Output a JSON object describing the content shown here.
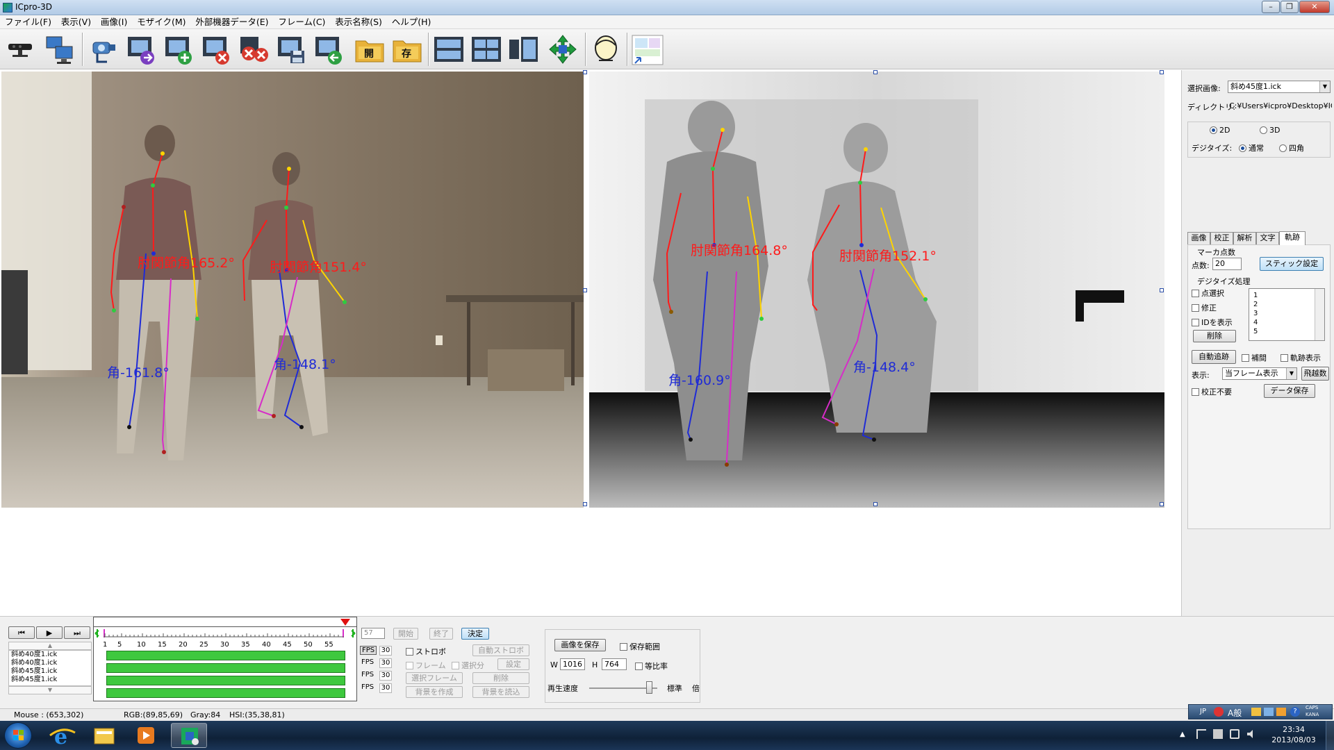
{
  "app": {
    "title": "ICpro-3D"
  },
  "menu": [
    "ファイル(F)",
    "表示(V)",
    "画像(I)",
    "モザイク(M)",
    "外部機器データ(E)",
    "フレーム(C)",
    "表示名称(S)",
    "ヘルプ(H)"
  ],
  "toolbar": {
    "icons": [
      "kinect-sensor-icon",
      "monitor-network-icon",
      "camera-link-icon",
      "film-next-icon",
      "film-add-icon",
      "film-remove-icon",
      "film-delete-icon",
      "film-save-icon",
      "film-back-icon",
      "folder-open-icon",
      "folder-save-icon",
      "film-grid-icon",
      "film-multi-icon",
      "film-split-icon",
      "move-arrows-icon",
      "head-model-icon",
      "preview-thumbnail-icon"
    ],
    "open_label": "開",
    "save_label": "存"
  },
  "colors": {
    "titlebar": "#b9d1ea",
    "accent_blue": "#1b4d9a",
    "frame_bar": "#3ec83e",
    "play_marker": "#e01010"
  },
  "rgb_view": {
    "angles": [
      {
        "label": "肘関節角165.2°",
        "color": "#ff1a1a"
      },
      {
        "label": "肘関節角151.4°",
        "color": "#ff1a1a"
      },
      {
        "label": "角-161.8°",
        "color": "#1f2bd6"
      },
      {
        "label": "角-148.1°",
        "color": "#1f2bd6"
      }
    ]
  },
  "depth_view": {
    "angles": [
      {
        "label": "肘関節角164.8°",
        "color": "#ff1a1a"
      },
      {
        "label": "肘関節角152.1°",
        "color": "#ff1a1a"
      },
      {
        "label": "角-160.9°",
        "color": "#1f2bd6"
      },
      {
        "label": "角-148.4°",
        "color": "#1f2bd6"
      }
    ]
  },
  "side": {
    "selected_image_label": "選択画像:",
    "selected_image_value": "斜め45度1.ick",
    "directory_label": "ディレクトリ:",
    "directory_value": "C:¥Users¥icpro¥Desktop¥IC",
    "mode_2d": "2D",
    "mode_3d": "3D",
    "digitize_label": "デジタイズ:",
    "digitize_normal": "通常",
    "digitize_square": "四角",
    "tabs": [
      "画像",
      "校正",
      "解析",
      "文字",
      "軌跡"
    ],
    "active_tab": "軌跡",
    "marker_count_label": "マーカ点数",
    "points_label": "点数:",
    "points_value": "20",
    "stick_button": "スティック設定",
    "digitize_proc_label": "デジタイズ処理",
    "point_select": "点選択",
    "modify": "修正",
    "show_id": "IDを表示",
    "delete_button": "削除",
    "point_list": [
      "1",
      "2",
      "3",
      "4",
      "5"
    ],
    "auto_track_button": "自動追跡",
    "interpolate": "補間",
    "show_track": "軌跡表示",
    "display_label": "表示:",
    "display_value": "当フレーム表示",
    "jump_button": "飛越数",
    "no_calibration": "校正不要",
    "data_save_button": "データ保存"
  },
  "timeline": {
    "ticks": [
      "1",
      "5",
      "10",
      "15",
      "20",
      "25",
      "30",
      "35",
      "40",
      "45",
      "50",
      "55"
    ],
    "current_frame": "57",
    "start_button": "開始",
    "end_button": "終了",
    "decide_button": "決定",
    "files": [
      "斜め40度1.ick",
      "斜め40度1.ick",
      "斜め45度1.ick",
      "斜め45度1.ick"
    ],
    "fps_label": "FPS",
    "fps_values": [
      "30",
      "30",
      "30",
      "30"
    ]
  },
  "controls": {
    "strobe": "ストロボ",
    "auto_strobe_button": "自動ストロボ",
    "frame": "フレーム",
    "selection": "選択分",
    "settings_button": "設定",
    "select_frame_button": "選択フレーム",
    "delete_button": "削除",
    "make_bg_button": "背景を作成",
    "load_bg_button": "背景を読込",
    "save_image_button": "画像を保存",
    "save_range": "保存範囲",
    "w_label": "W",
    "w_value": "1016",
    "h_label": "H",
    "h_value": "764",
    "ratio": "等比率",
    "speed_label": "再生速度",
    "speed_value": "標準",
    "speed_unit": "倍"
  },
  "status": {
    "mouse": "Mouse : (653,302)",
    "rgb": "RGB:(89,85,69)",
    "gray": "Gray:84",
    "hsi": "HSI:(35,38,81)"
  },
  "taskbar": {
    "time": "23:34",
    "date": "2013/08/03",
    "ime": "JP",
    "ime_mode": "A般",
    "caps": "CAPS",
    "kana": "KANA"
  }
}
